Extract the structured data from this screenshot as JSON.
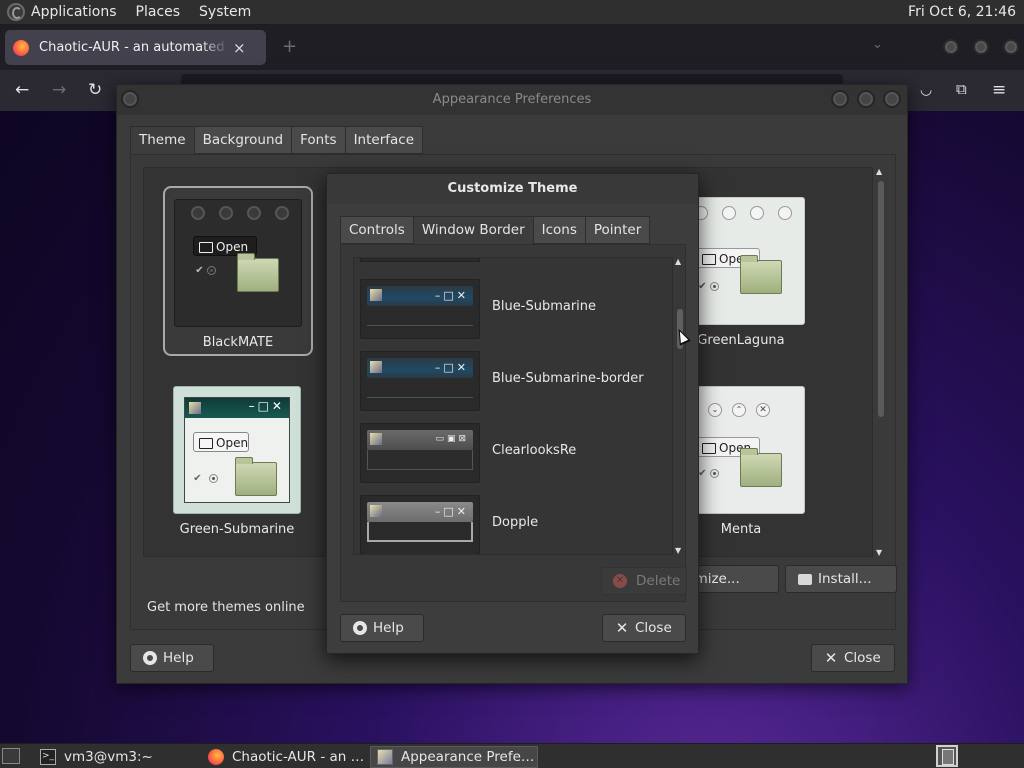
{
  "top_panel": {
    "menus": [
      "Applications",
      "Places",
      "System"
    ],
    "clock": "Fri Oct  6, 21:46"
  },
  "firefox": {
    "tab_title": "Chaotic-AUR - an automated building repo",
    "tab_close": "×",
    "new_tab": "+",
    "nav": {
      "back": "←",
      "forward": "→",
      "reload": "↻"
    },
    "toolbar_icons": [
      "pocket-icon",
      "extensions-icon",
      "menu-icon"
    ]
  },
  "appearance": {
    "title": "Appearance Preferences",
    "tabs": [
      "Theme",
      "Background",
      "Fonts",
      "Interface"
    ],
    "themes": [
      {
        "name": "BlackMATE",
        "selected": true
      },
      {
        "name": "GreenLaguna",
        "selected": false
      },
      {
        "name": "Green-Submarine",
        "selected": false
      },
      {
        "name": "Menta",
        "selected": false
      }
    ],
    "preview_open": "Open",
    "get_more": "Get more themes online",
    "customize_label": "Customize...",
    "install_label": "Install...",
    "help_label": "Help",
    "close_label": "Close"
  },
  "customize": {
    "title": "Customize Theme",
    "tabs": [
      "Controls",
      "Window Border",
      "Icons",
      "Pointer"
    ],
    "active_tab": "Window Border",
    "borders": [
      {
        "name": "Blue-Submarine",
        "style": "blue"
      },
      {
        "name": "Blue-Submarine-border",
        "style": "blue"
      },
      {
        "name": "ClearlooksRe",
        "style": "grey"
      },
      {
        "name": "Dopple",
        "style": "light"
      }
    ],
    "delete_label": "Delete",
    "help_label": "Help",
    "close_label": "Close"
  },
  "taskbar": {
    "tasks": [
      {
        "label": "vm3@vm3:~",
        "icon": "terminal-icon"
      },
      {
        "label": "Chaotic-AUR - an automated building repo",
        "icon": "firefox-icon"
      },
      {
        "label": "Appearance Preferences",
        "icon": "appearance-icon"
      }
    ]
  },
  "colors": {
    "panel": "#2f2f2f",
    "window": "#3b3b3b",
    "accent_folder": "#9fb07e"
  }
}
